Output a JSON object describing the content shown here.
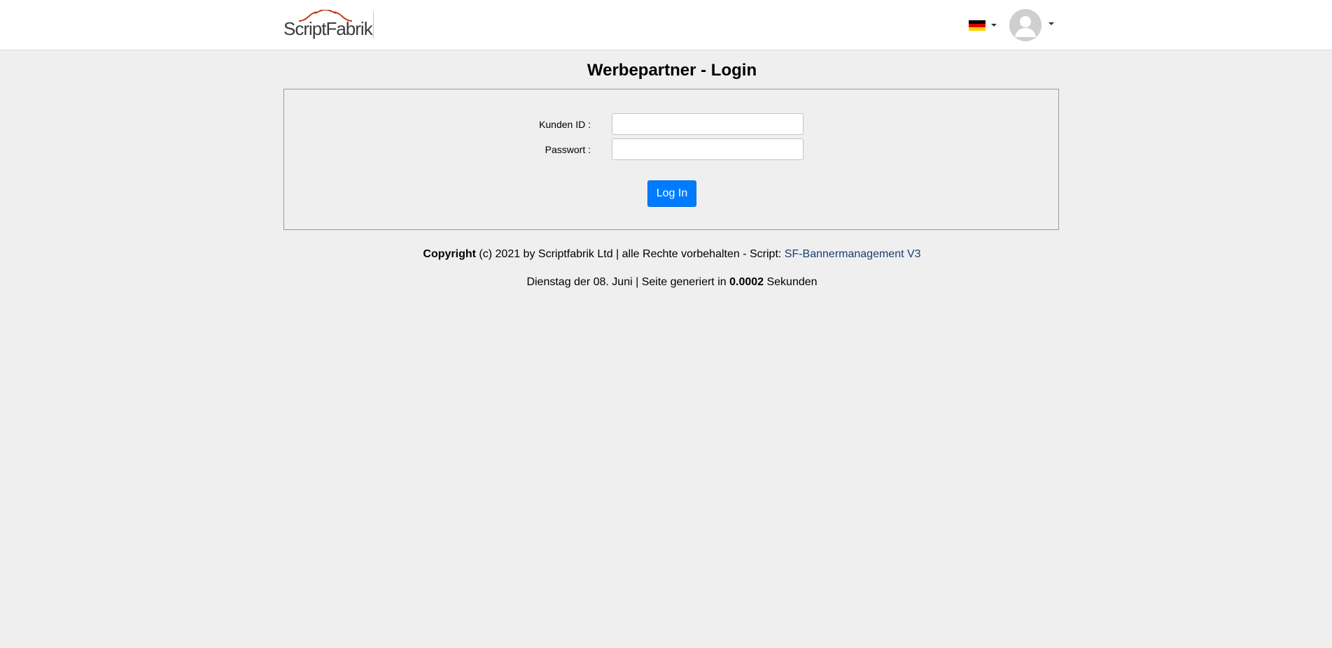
{
  "header": {
    "logo_text": "ScriptFabrik",
    "language_flag": "de-flag",
    "flag_colors": [
      "#000000",
      "#dd0000",
      "#ffce00"
    ],
    "avatar_icon": "user-avatar-icon"
  },
  "page": {
    "title": "Werbepartner - Login"
  },
  "login_form": {
    "customer_id_label": "Kunden ID :",
    "customer_id_value": "",
    "password_label": "Passwort :",
    "password_value": "",
    "submit_label": "Log In"
  },
  "footer": {
    "copyright_bold": "Copyright",
    "copyright_text": " (c) 2021 by Scriptfabrik Ltd | alle Rechte vorbehalten - Script: ",
    "script_link": "SF-Bannermanagement V3",
    "date_prefix": "Dienstag der 08. Juni | Seite generiert in ",
    "generation_time": "0.0002",
    "date_suffix": " Sekunden"
  },
  "colors": {
    "accent": "#007bff",
    "background": "#efefef",
    "link": "#1a3d75",
    "logo_arc": "#c0391b"
  }
}
